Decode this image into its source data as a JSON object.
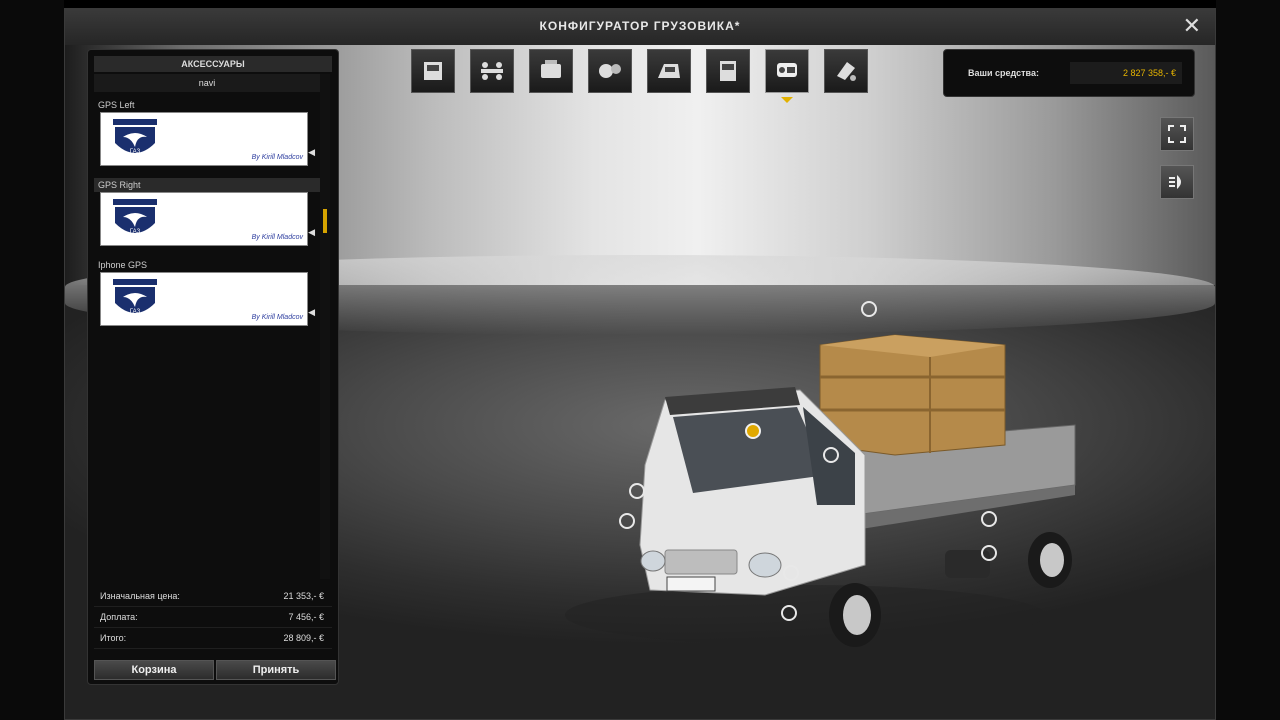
{
  "window": {
    "title": "КОНФИГУРАТОР ГРУЗОВИКА*",
    "close_glyph": "✕"
  },
  "panel": {
    "header": "АКСЕССУАРЫ",
    "subheader": "navi",
    "items": [
      {
        "label": "GPS Left",
        "thumb_caption": "By Kirill Mladcov",
        "selected": false
      },
      {
        "label": "GPS Right",
        "thumb_caption": "By Kirill Mladcov",
        "selected": true
      },
      {
        "label": "Iphone GPS",
        "thumb_caption": "By Kirill Mladcov",
        "selected": false
      }
    ],
    "logo_text": "ГАЗ",
    "summary": {
      "base_label": "Изначальная цена:",
      "base_value": "21 353,- €",
      "extra_label": "Доплата:",
      "extra_value": "7 456,- €",
      "total_label": "Итого:",
      "total_value": "28 809,- €"
    },
    "buttons": {
      "cart": "Корзина",
      "accept": "Принять"
    }
  },
  "toolbar": {
    "tabs": [
      {
        "icon": "truck-cab-icon"
      },
      {
        "icon": "chassis-icon"
      },
      {
        "icon": "engine-icon"
      },
      {
        "icon": "transmission-icon"
      },
      {
        "icon": "cabin-interior-icon"
      },
      {
        "icon": "cab-front-icon"
      },
      {
        "icon": "accessories-icon",
        "active": true
      },
      {
        "icon": "paint-icon"
      }
    ]
  },
  "funds": {
    "label": "Ваши средства:",
    "value": "2 827 358,- €"
  },
  "side_buttons": [
    {
      "icon": "fullscreen-icon"
    },
    {
      "icon": "headlight-icon"
    }
  ],
  "colors": {
    "accent": "#e0a800",
    "panel_bg": "#0d0d0d",
    "funds_text": "#e6b400"
  }
}
